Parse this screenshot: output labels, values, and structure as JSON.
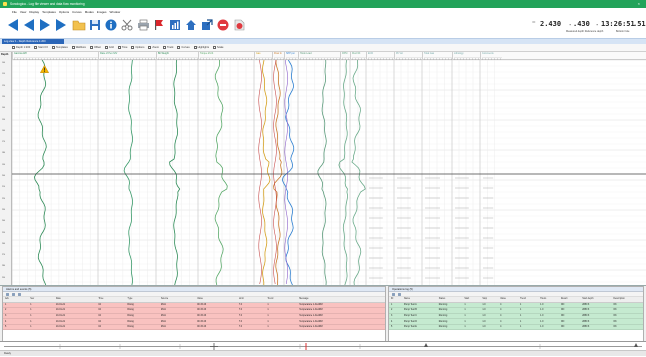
{
  "window": {
    "title": "Sonologica - Log file viewer and data flow monitoring"
  },
  "menu": [
    "File",
    "View",
    "Display",
    "Templates",
    "Options",
    "Curves",
    "Modes",
    "Images",
    "Window"
  ],
  "toolbar": {
    "buttons": [
      "first-frame",
      "previous",
      "play",
      "next",
      "open-folder",
      "save",
      "info",
      "cut",
      "print",
      "flag",
      "chart",
      "home",
      "export",
      "stop",
      "pdf"
    ],
    "depth_start": "2.430",
    "depth_end": ".430",
    "time": "13:26:51",
    "time_suffix": ".51",
    "readout_sub_left": "Measured depth  Reference depth",
    "readout_sub_right": "Bottom hole"
  },
  "view_tab": "Log view 1 - Depth Reference 1:200",
  "subtoolbar": [
    "Depth 1:200",
    "Start 0 ft",
    "Templates",
    "Wellbore",
    "Offset",
    "Grid",
    "Time",
    "Options",
    "Zoom",
    "Track",
    "Curves",
    "Highlights",
    "Scale"
  ],
  "depth_column": {
    "label": "Depth",
    "ticks": [
      "100",
      "110",
      "120",
      "130",
      "140",
      "150",
      "160",
      "170",
      "180",
      "190",
      "200",
      "210",
      "220",
      "230",
      "240",
      "250",
      "260",
      "270",
      "280",
      "290"
    ]
  },
  "tracks": [
    {
      "name": "Gamma API",
      "color": "#2e8b57"
    },
    {
      "name": "Rate of Pen ft/hr",
      "color": "#3a9a6a"
    },
    {
      "name": "Bit Weight",
      "color": "#2e8b57"
    },
    {
      "name": "Torque kft-lb",
      "color": "#5aaa6a"
    },
    {
      "name": "Gas",
      "color": "#d4a020"
    },
    {
      "name": "Flow In",
      "color": "#c97a2a"
    },
    {
      "name": "SPP psi",
      "color": "#2d7fd0"
    },
    {
      "name": "Hook Load",
      "color": "#5a9a7a"
    },
    {
      "name": "RPM",
      "color": "#6aaa8a"
    },
    {
      "name": "Mud Wt",
      "color": "#6aaa8a"
    },
    {
      "name": "ECD",
      "color": "#7aa",
      "empty": true
    },
    {
      "name": "Pit Vol",
      "color": "#7aa",
      "empty": true
    },
    {
      "name": "Total Gas",
      "color": "#7aa",
      "empty": true
    },
    {
      "name": "Lithology",
      "color": "#7aa",
      "empty": true
    },
    {
      "name": "Comments",
      "color": "#7aa",
      "empty": true
    }
  ],
  "bottom_left_panel": {
    "title": "Alarms and events (5)",
    "columns": [
      "Ack",
      "Sev",
      "Date",
      "Time",
      "Type",
      "Source",
      "Value",
      "Limit",
      "Trend",
      "Message"
    ],
    "rows": [
      [
        "1",
        "1",
        "10-01-21",
        "04",
        "Rising",
        "2611",
        "00.15.43",
        "7.0",
        "1",
        "Temperature 1 ALARM"
      ],
      [
        "2",
        "1",
        "10-01-21",
        "04",
        "Rising",
        "2611",
        "00.15.43",
        "7.0",
        "1",
        "Temperature 1 ALARM"
      ],
      [
        "3",
        "1",
        "10-01-21",
        "04",
        "Rising",
        "2611",
        "00.15.43",
        "7.0",
        "1",
        "Temperature 1 ALARM"
      ],
      [
        "4",
        "1",
        "10-01-21",
        "04",
        "Rising",
        "2611",
        "00.15.43",
        "7.0",
        "1",
        "Temperature 1 ALARM"
      ],
      [
        "5",
        "1",
        "10-01-21",
        "04",
        "Rising",
        "2611",
        "00.15.43",
        "7.0",
        "1",
        "Temperature 1 ALARM"
      ]
    ]
  },
  "bottom_right_panel": {
    "title": "Operations log (5)",
    "columns": [
      "ID",
      "Name",
      "Status",
      "Start",
      "Stop",
      "Value",
      "Trend",
      "Hours",
      "Result",
      "Start depth",
      "Description"
    ],
    "rows": [
      [
        "1",
        "Pump Test A",
        "Running",
        "1",
        "1.0",
        "4",
        "1",
        "1.0",
        "ON",
        "2880 ft",
        "OK"
      ],
      [
        "2",
        "Pump Test B",
        "Running",
        "1",
        "1.0",
        "4",
        "1",
        "1.0",
        "ON",
        "2880 ft",
        "OK"
      ],
      [
        "3",
        "Pump Test C",
        "Running",
        "1",
        "1.0",
        "4",
        "1",
        "1.0",
        "ON",
        "2880 ft",
        "OK"
      ],
      [
        "4",
        "Pump Test D",
        "Running",
        "1",
        "1.0",
        "4",
        "1",
        "1.0",
        "ON",
        "2880 ft",
        "OK"
      ],
      [
        "5",
        "Pump Test E",
        "Running",
        "1",
        "1.0",
        "4",
        "1",
        "1.0",
        "ON",
        "2880 ft",
        "OK"
      ]
    ]
  },
  "status": "Ready"
}
